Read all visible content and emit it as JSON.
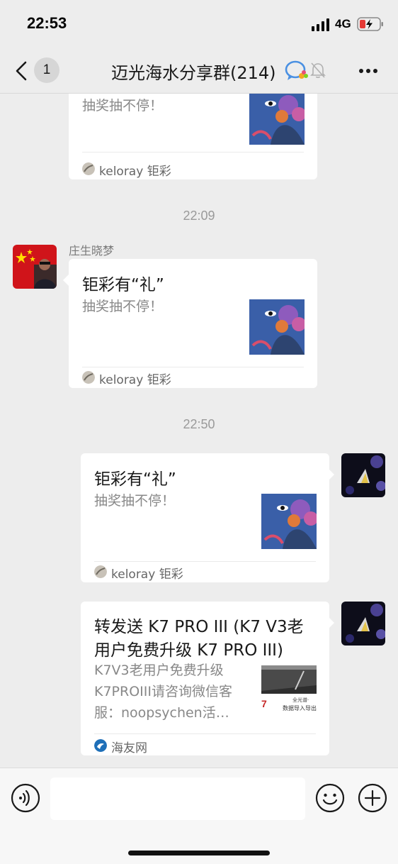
{
  "status_bar": {
    "time": "22:53",
    "network": "4G",
    "icons": [
      "signal-icon",
      "battery-charging-icon"
    ]
  },
  "nav": {
    "back_icon": "chevron-left-icon",
    "unread_count": "1",
    "title": "迈光海水分享群(214)",
    "icons": [
      "group-chat-icon",
      "mute-bell-icon",
      "more-icon"
    ]
  },
  "messages": [
    {
      "type": "card-partial",
      "desc": "抽奖抽不停！",
      "source": "keloray 钜彩"
    },
    {
      "type": "timestamp",
      "text": "22:09"
    },
    {
      "type": "card-received",
      "sender": "庄生晓梦",
      "title": "钜彩有“礼”",
      "desc": "抽奖抽不停！",
      "source": "keloray 钜彩"
    },
    {
      "type": "timestamp",
      "text": "22:50"
    },
    {
      "type": "card-sent",
      "title": "钜彩有“礼”",
      "desc": "抽奖抽不停！",
      "source": "keloray 钜彩"
    },
    {
      "type": "card-sent",
      "title_line1": "转发送 K7 PRO III (K7 V3老",
      "title_line2": "用户免费升级 K7 PRO III)",
      "desc_line1": "K7V3老用户免费升级",
      "desc_line2": "K7PROIII请咨询微信客",
      "desc_line3": "服：noopsychen活…",
      "thumb_text_1": "7",
      "thumb_text_2": "全光谱·",
      "thumb_text_3": "数据导入导出",
      "source": "海友网"
    }
  ],
  "input_bar": {
    "placeholder": "",
    "icons": [
      "voice-icon",
      "emoji-icon",
      "plus-icon"
    ]
  }
}
